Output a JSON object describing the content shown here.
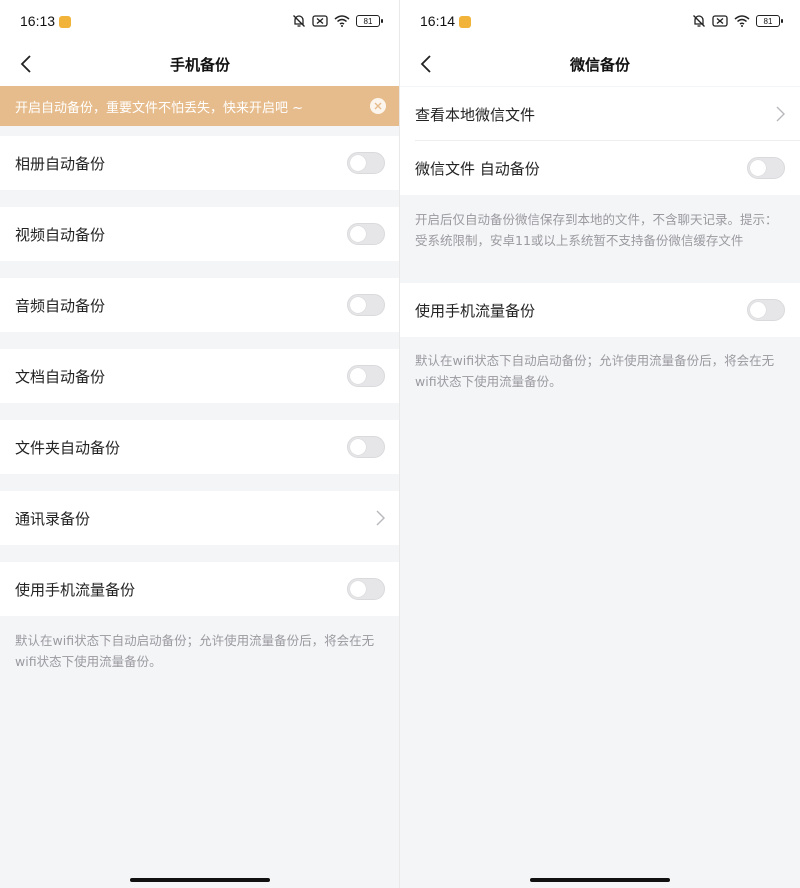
{
  "left": {
    "status": {
      "time": "16:13",
      "battery": "81"
    },
    "nav": {
      "title": "手机备份"
    },
    "banner": {
      "text": "开启自动备份，重要文件不怕丢失，快来开启吧 ~"
    },
    "rows": [
      {
        "label": "相册自动备份",
        "type": "toggle",
        "on": false
      },
      {
        "label": "视频自动备份",
        "type": "toggle",
        "on": false
      },
      {
        "label": "音频自动备份",
        "type": "toggle",
        "on": false
      },
      {
        "label": "文档自动备份",
        "type": "toggle",
        "on": false
      },
      {
        "label": "文件夹自动备份",
        "type": "toggle",
        "on": false
      },
      {
        "label": "通讯录备份",
        "type": "chevron"
      },
      {
        "label": "使用手机流量备份",
        "type": "toggle",
        "on": false
      }
    ],
    "note": "默认在wifi状态下自动启动备份；允许使用流量备份后，将会在无wifi状态下使用流量备份。"
  },
  "right": {
    "status": {
      "time": "16:14",
      "battery": "81"
    },
    "nav": {
      "title": "微信备份"
    },
    "rows": [
      {
        "label": "查看本地微信文件",
        "type": "chevron"
      },
      {
        "label": "微信文件 自动备份",
        "type": "toggle",
        "on": false
      },
      {
        "label": "使用手机流量备份",
        "type": "toggle",
        "on": false
      }
    ],
    "note1": "开启后仅自动备份微信保存到本地的文件，不含聊天记录。提示：受系统限制，安卓11或以上系统暂不支持备份微信缓存文件",
    "note2": "默认在wifi状态下自动启动备份；允许使用流量备份后，将会在无wifi状态下使用流量备份。"
  },
  "colors": {
    "banner": "#e7bc8c",
    "background": "#f4f5f7",
    "toggle_off": "#e6e6e8"
  },
  "icons": [
    "back-arrow-icon",
    "close-icon",
    "chevron-right-icon",
    "mute-bell-icon",
    "sim-off-icon",
    "wifi-icon",
    "battery-icon"
  ]
}
